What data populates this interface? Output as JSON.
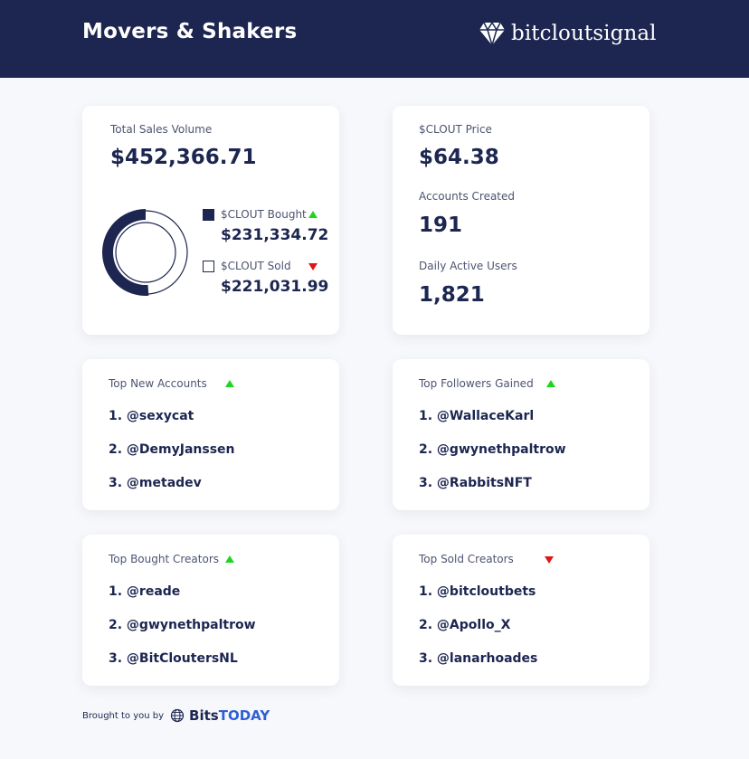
{
  "header": {
    "title": "Movers & Shakers",
    "brand": "bitcloutsignal"
  },
  "sales": {
    "label": "Total Sales Volume",
    "value": "$452,366.71",
    "bought_label": "$CLOUT Bought",
    "bought_value": "$231,334.72",
    "sold_label": "$CLOUT Sold",
    "sold_value": "$221,031.99",
    "bought_fraction": 0.511
  },
  "stats": {
    "price_label": "$CLOUT Price",
    "price_value": "$64.38",
    "accounts_label": "Accounts Created",
    "accounts_value": "191",
    "dau_label": "Daily Active Users",
    "dau_value": "1,821"
  },
  "lists": {
    "new_accounts": {
      "title": "Top New Accounts",
      "trend": "up",
      "items": [
        "1. @sexycat",
        "2. @DemyJanssen",
        "3. @metadev"
      ]
    },
    "followers": {
      "title": "Top Followers Gained",
      "trend": "up",
      "items": [
        "1. @WallaceKarl",
        "2. @gwynethpaltrow",
        "3. @RabbitsNFT"
      ]
    },
    "bought": {
      "title": "Top Bought Creators",
      "trend": "up",
      "items": [
        "1. @reade",
        "2. @gwynethpaltrow",
        "3. @BitCloutersNL"
      ]
    },
    "sold": {
      "title": "Top Sold Creators",
      "trend": "down",
      "items": [
        "1. @bitcloutbets",
        "2. @Apollo_X",
        "3. @lanarhoades"
      ]
    }
  },
  "footer": {
    "text": "Brought to you by",
    "brand_a": "Bits",
    "brand_b": "TODAY"
  },
  "colors": {
    "navy": "#1c2650",
    "up": "#1fd51f",
    "down": "#e01515",
    "brand_blue": "#2f5fd8"
  },
  "icons": {
    "logo": "diamond-icon",
    "footer": "globe-icon",
    "trend_up": "triangle-up-icon",
    "trend_down": "triangle-down-icon"
  }
}
